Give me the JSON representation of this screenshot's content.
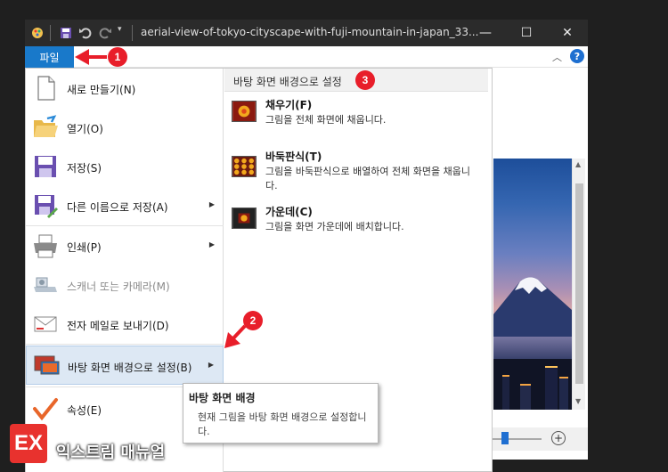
{
  "window": {
    "title": "aerial-view-of-tokyo-cityscape-with-fuji-mountain-in-japan_33...",
    "minimize_glyph": "—",
    "maximize_glyph": "☐",
    "close_glyph": "✕"
  },
  "ribbon": {
    "file_tab": "파일"
  },
  "file_menu": {
    "items": [
      {
        "label": "새로 만들기(N)",
        "icon": "new-document-icon"
      },
      {
        "label": "열기(O)",
        "icon": "open-folder-icon"
      },
      {
        "label": "저장(S)",
        "icon": "save-icon"
      },
      {
        "label": "다른 이름으로 저장(A)",
        "icon": "save-as-icon"
      },
      {
        "label": "인쇄(P)",
        "icon": "printer-icon"
      },
      {
        "label": "스캐너 또는 카메라(M)",
        "icon": "scanner-icon"
      },
      {
        "label": "전자 메일로 보내기(D)",
        "icon": "email-icon"
      },
      {
        "label": "바탕 화면 배경으로 설정(B)",
        "icon": "desktop-background-icon"
      },
      {
        "label": "속성(E)",
        "icon": "properties-checkmark-icon"
      }
    ]
  },
  "submenu": {
    "header": "바탕 화면 배경으로 설정",
    "options": [
      {
        "name": "채우기(F)",
        "desc": "그림을 전체 화면에 채웁니다."
      },
      {
        "name": "바둑판식(T)",
        "desc": "그림을 바둑판식으로 배열하여 전체 화면을 채웁니다."
      },
      {
        "name": "가운데(C)",
        "desc": "그림을 화면 가운데에 배치합니다."
      }
    ]
  },
  "tooltip": {
    "title": "바탕 화면 배경",
    "body": "현재 그림을 바탕 화면 배경으로 설정합니다."
  },
  "annotations": {
    "badge1": "1",
    "badge2": "2",
    "badge3": "3",
    "color": "#e81e2a"
  },
  "watermark": {
    "tagline": "More Better IT Life",
    "name": "익스트림 매뉴얼",
    "logo_mark": "EX"
  },
  "colors": {
    "accent": "#1979ca",
    "selected_bg": "#dde8f4"
  }
}
